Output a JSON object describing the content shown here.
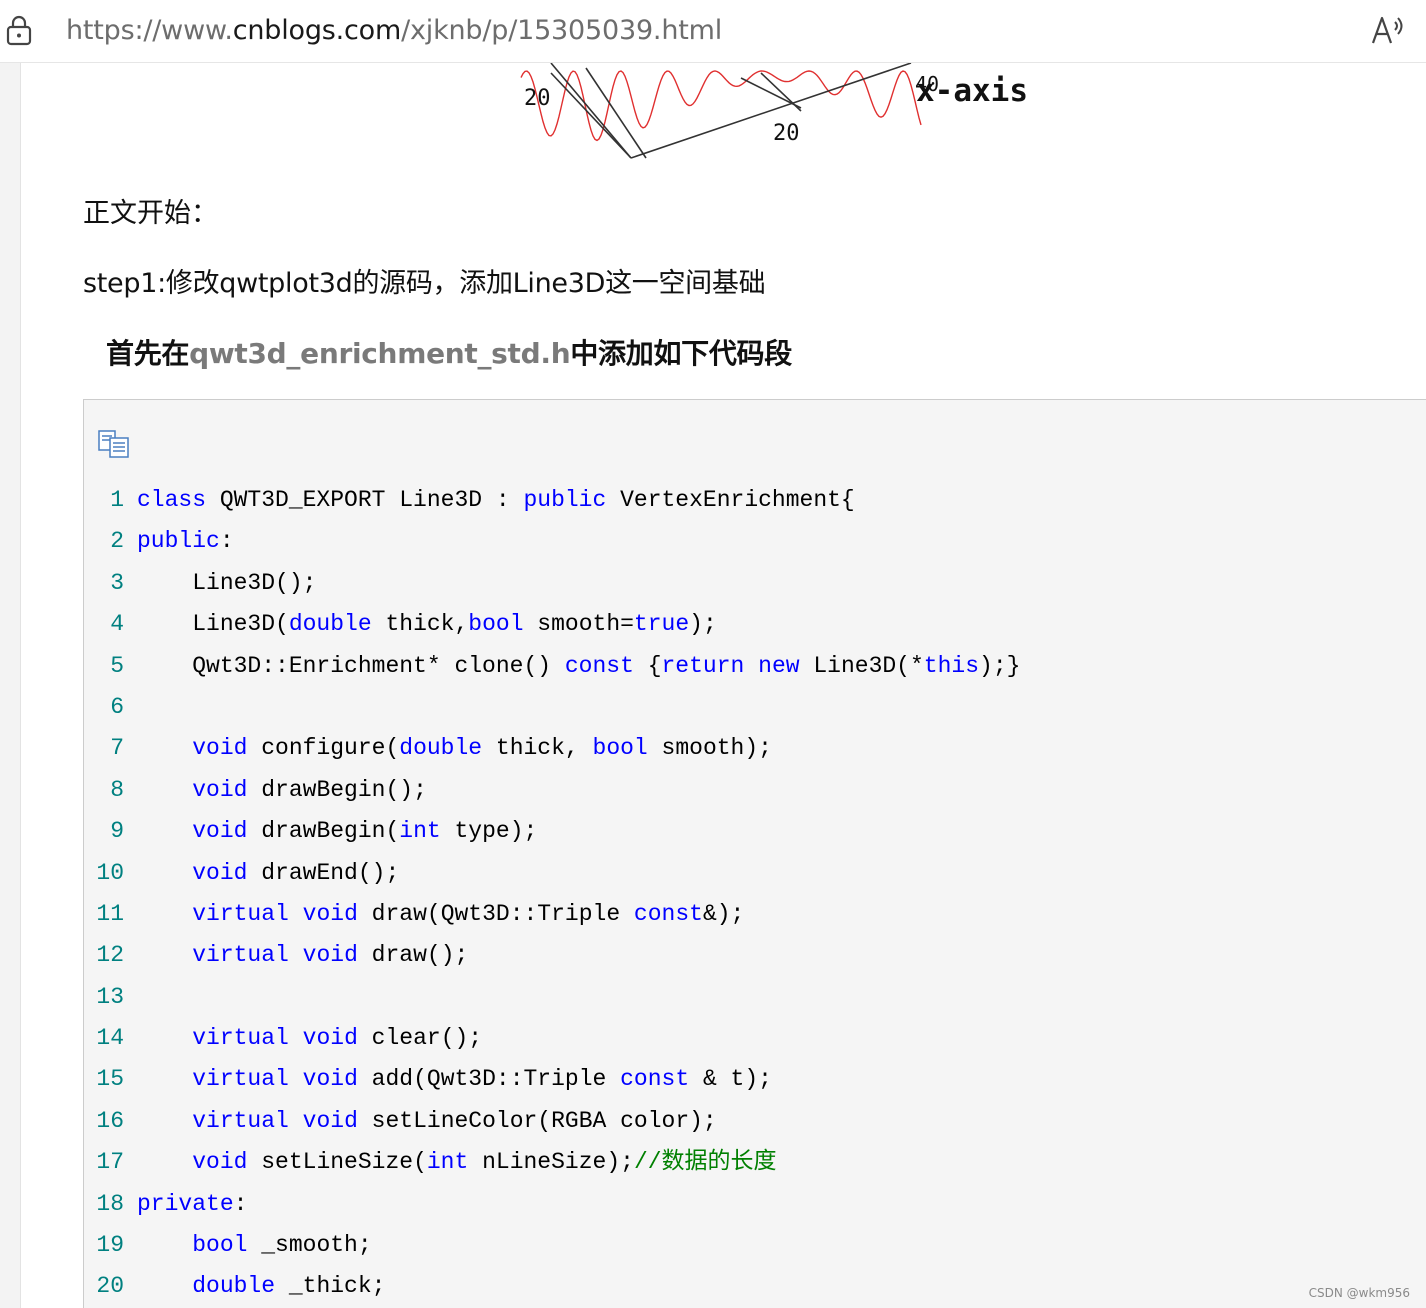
{
  "browser": {
    "url_prefix": "https://www.",
    "url_domain": "cnblogs.com",
    "url_path": "/xjknb/p/15305039.html",
    "icons": {
      "lock": "lock-icon",
      "read_aloud": "read-aloud-icon"
    }
  },
  "figure": {
    "ticks": [
      "20",
      "20",
      "40"
    ],
    "axis_label": "x-axis",
    "curve_color": "#e03030"
  },
  "article": {
    "intro": "正文开始：",
    "step1": "step1:修改qwtplot3d的源码，添加Line3D这一空间基础",
    "heading_prefix": "首先在",
    "heading_file": "qwt3d_enrichment_std.h",
    "heading_suffix": "中添加如下代码段"
  },
  "code": {
    "copy_icon": "copy-icon",
    "lines": [
      {
        "n": "1",
        "t": [
          [
            "kw",
            "class"
          ],
          [
            "tx",
            " QWT3D_EXPORT Line3D : "
          ],
          [
            "kw",
            "public"
          ],
          [
            "tx",
            " VertexEnrichment{"
          ]
        ]
      },
      {
        "n": "2",
        "t": [
          [
            "kw",
            "public"
          ],
          [
            "tx",
            ":"
          ]
        ]
      },
      {
        "n": "3",
        "t": [
          [
            "tx",
            "    Line3D();"
          ]
        ]
      },
      {
        "n": "4",
        "t": [
          [
            "tx",
            "    Line3D("
          ],
          [
            "kw",
            "double"
          ],
          [
            "tx",
            " thick,"
          ],
          [
            "kw",
            "bool"
          ],
          [
            "tx",
            " smooth="
          ],
          [
            "kw",
            "true"
          ],
          [
            "tx",
            ");"
          ]
        ]
      },
      {
        "n": "5",
        "t": [
          [
            "tx",
            "    Qwt3D::Enrichment* clone() "
          ],
          [
            "kw",
            "const"
          ],
          [
            "tx",
            " {"
          ],
          [
            "kw",
            "return"
          ],
          [
            "tx",
            " "
          ],
          [
            "kw",
            "new"
          ],
          [
            "tx",
            " Line3D(*"
          ],
          [
            "kw",
            "this"
          ],
          [
            "tx",
            ");}"
          ]
        ]
      },
      {
        "n": "6",
        "t": []
      },
      {
        "n": "7",
        "t": [
          [
            "tx",
            "    "
          ],
          [
            "kw",
            "void"
          ],
          [
            "tx",
            " configure("
          ],
          [
            "kw",
            "double"
          ],
          [
            "tx",
            " thick, "
          ],
          [
            "kw",
            "bool"
          ],
          [
            "tx",
            " smooth);"
          ]
        ]
      },
      {
        "n": "8",
        "t": [
          [
            "tx",
            "    "
          ],
          [
            "kw",
            "void"
          ],
          [
            "tx",
            " drawBegin();"
          ]
        ]
      },
      {
        "n": "9",
        "t": [
          [
            "tx",
            "    "
          ],
          [
            "kw",
            "void"
          ],
          [
            "tx",
            " drawBegin("
          ],
          [
            "kw",
            "int"
          ],
          [
            "tx",
            " type);"
          ]
        ]
      },
      {
        "n": "10",
        "t": [
          [
            "tx",
            "    "
          ],
          [
            "kw",
            "void"
          ],
          [
            "tx",
            " drawEnd();"
          ]
        ]
      },
      {
        "n": "11",
        "t": [
          [
            "tx",
            "    "
          ],
          [
            "kw",
            "virtual"
          ],
          [
            "tx",
            " "
          ],
          [
            "kw",
            "void"
          ],
          [
            "tx",
            " draw(Qwt3D::Triple "
          ],
          [
            "kw",
            "const"
          ],
          [
            "tx",
            "&);"
          ]
        ]
      },
      {
        "n": "12",
        "t": [
          [
            "tx",
            "    "
          ],
          [
            "kw",
            "virtual"
          ],
          [
            "tx",
            " "
          ],
          [
            "kw",
            "void"
          ],
          [
            "tx",
            " draw();"
          ]
        ]
      },
      {
        "n": "13",
        "t": []
      },
      {
        "n": "14",
        "t": [
          [
            "tx",
            "    "
          ],
          [
            "kw",
            "virtual"
          ],
          [
            "tx",
            " "
          ],
          [
            "kw",
            "void"
          ],
          [
            "tx",
            " clear();"
          ]
        ]
      },
      {
        "n": "15",
        "t": [
          [
            "tx",
            "    "
          ],
          [
            "kw",
            "virtual"
          ],
          [
            "tx",
            " "
          ],
          [
            "kw",
            "void"
          ],
          [
            "tx",
            " add(Qwt3D::Triple "
          ],
          [
            "kw",
            "const"
          ],
          [
            "tx",
            " & t);"
          ]
        ]
      },
      {
        "n": "16",
        "t": [
          [
            "tx",
            "    "
          ],
          [
            "kw",
            "virtual"
          ],
          [
            "tx",
            " "
          ],
          [
            "kw",
            "void"
          ],
          [
            "tx",
            " setLineColor(RGBA color);"
          ]
        ]
      },
      {
        "n": "17",
        "t": [
          [
            "tx",
            "    "
          ],
          [
            "kw",
            "void"
          ],
          [
            "tx",
            " setLineSize("
          ],
          [
            "kw",
            "int"
          ],
          [
            "tx",
            " nLineSize);"
          ],
          [
            "cm",
            "//数据的长度"
          ]
        ]
      },
      {
        "n": "18",
        "t": [
          [
            "kw",
            "private"
          ],
          [
            "tx",
            ":"
          ]
        ]
      },
      {
        "n": "19",
        "t": [
          [
            "tx",
            "    "
          ],
          [
            "kw",
            "bool"
          ],
          [
            "tx",
            " _smooth;"
          ]
        ]
      },
      {
        "n": "20",
        "t": [
          [
            "tx",
            "    "
          ],
          [
            "kw",
            "double"
          ],
          [
            "tx",
            " _thick;"
          ]
        ]
      }
    ]
  },
  "watermark": "CSDN @wkm956"
}
